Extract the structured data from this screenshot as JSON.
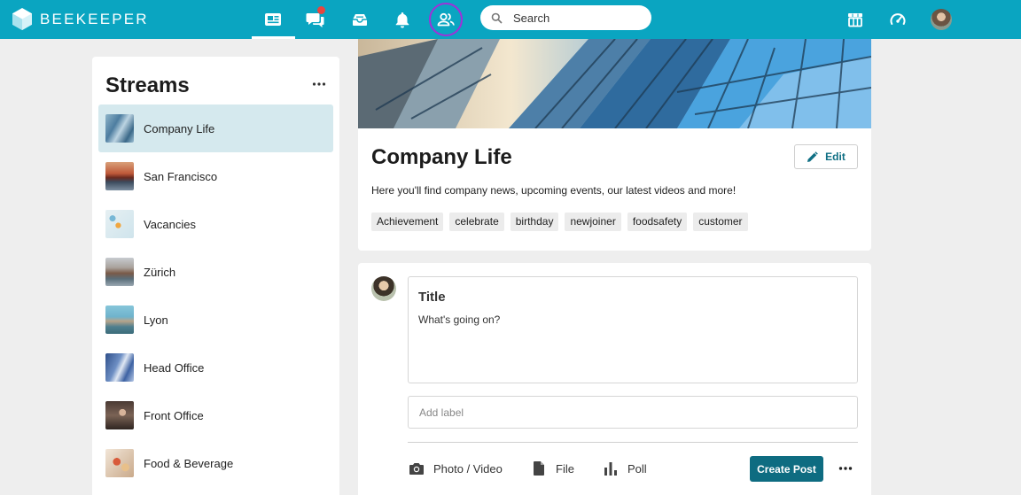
{
  "app": {
    "brand": "BEEKEEPER"
  },
  "colors": {
    "topbar": "#0aa5c1",
    "primary_button": "#0e6c81",
    "active_stream": "#d5e9ee",
    "notification": "#e8463f",
    "focus_ring": "#a030d8"
  },
  "nav": {
    "items": [
      {
        "icon": "news-feed-icon",
        "active": true
      },
      {
        "icon": "chat-icon",
        "has_notification": true
      },
      {
        "icon": "inbox-icon"
      },
      {
        "icon": "bell-icon"
      },
      {
        "icon": "people-icon",
        "highlighted": true
      }
    ],
    "right_items": [
      {
        "icon": "apps-store-icon"
      },
      {
        "icon": "dashboard-gauge-icon"
      },
      {
        "icon": "user-avatar"
      }
    ]
  },
  "search": {
    "placeholder": "Search"
  },
  "streams": {
    "title": "Streams",
    "items": [
      {
        "label": "Company Life",
        "active": true
      },
      {
        "label": "San Francisco"
      },
      {
        "label": "Vacancies"
      },
      {
        "label": "Zürich"
      },
      {
        "label": "Lyon"
      },
      {
        "label": "Head Office"
      },
      {
        "label": "Front Office"
      },
      {
        "label": "Food & Beverage"
      }
    ]
  },
  "stream": {
    "name": "Company Life",
    "edit_label": "Edit",
    "description": "Here you'll find company news, upcoming events, our latest videos and more!",
    "tags": [
      "Achievement",
      "celebrate",
      "birthday",
      "newjoiner",
      "foodsafety",
      "customer"
    ]
  },
  "composer": {
    "title_placeholder": "Title",
    "body_placeholder": "What's going on?",
    "label_placeholder": "Add label",
    "actions": {
      "photo": "Photo / Video",
      "file": "File",
      "poll": "Poll"
    },
    "create_label": "Create Post"
  }
}
